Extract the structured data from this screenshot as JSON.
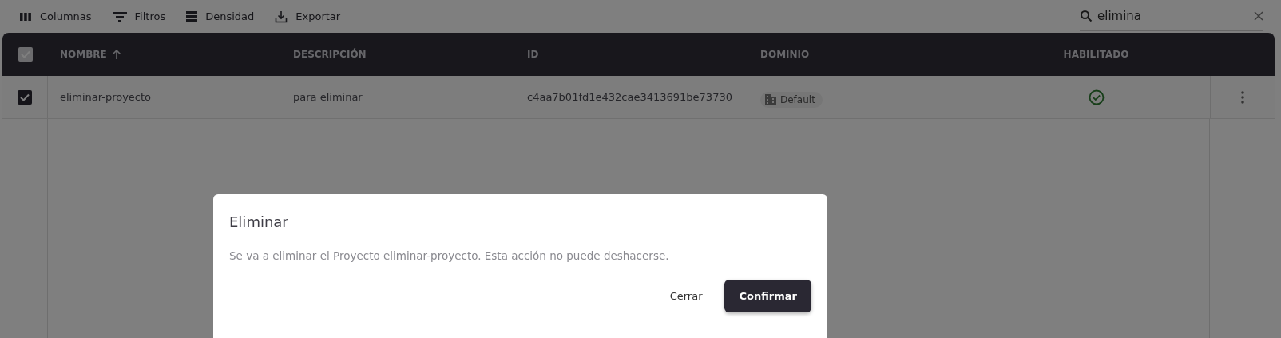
{
  "toolbar": {
    "buttons": [
      {
        "kind": "columns",
        "label": "Columnas"
      },
      {
        "kind": "filters",
        "label": "Filtros"
      },
      {
        "kind": "density",
        "label": "Densidad"
      },
      {
        "kind": "export",
        "label": "Exportar"
      }
    ],
    "search": {
      "value": "elimina"
    }
  },
  "table": {
    "all_checked": true,
    "columns": [
      {
        "label": "NOMBRE",
        "sorted": true
      },
      {
        "label": "DESCRIPCIÓN",
        "sorted": false
      },
      {
        "label": "ID",
        "sorted": false
      },
      {
        "label": "DOMINIO",
        "sorted": false
      },
      {
        "label": "HABILITADO",
        "sorted": false
      }
    ],
    "rows": [
      {
        "checked": true,
        "name": "eliminar-proyecto",
        "description": "para eliminar",
        "id": "c4aa7b01fd1e432cae3413691be73730",
        "domain": "Default",
        "enabled": true
      }
    ]
  },
  "dialog": {
    "title": "Eliminar",
    "message": "Se va a eliminar el Proyecto eliminar-proyecto. Esta acción no puede deshacerse.",
    "buttons": [
      {
        "kind": "text",
        "label": "Cerrar"
      },
      {
        "kind": "primary",
        "label": "Confirmar"
      }
    ]
  }
}
